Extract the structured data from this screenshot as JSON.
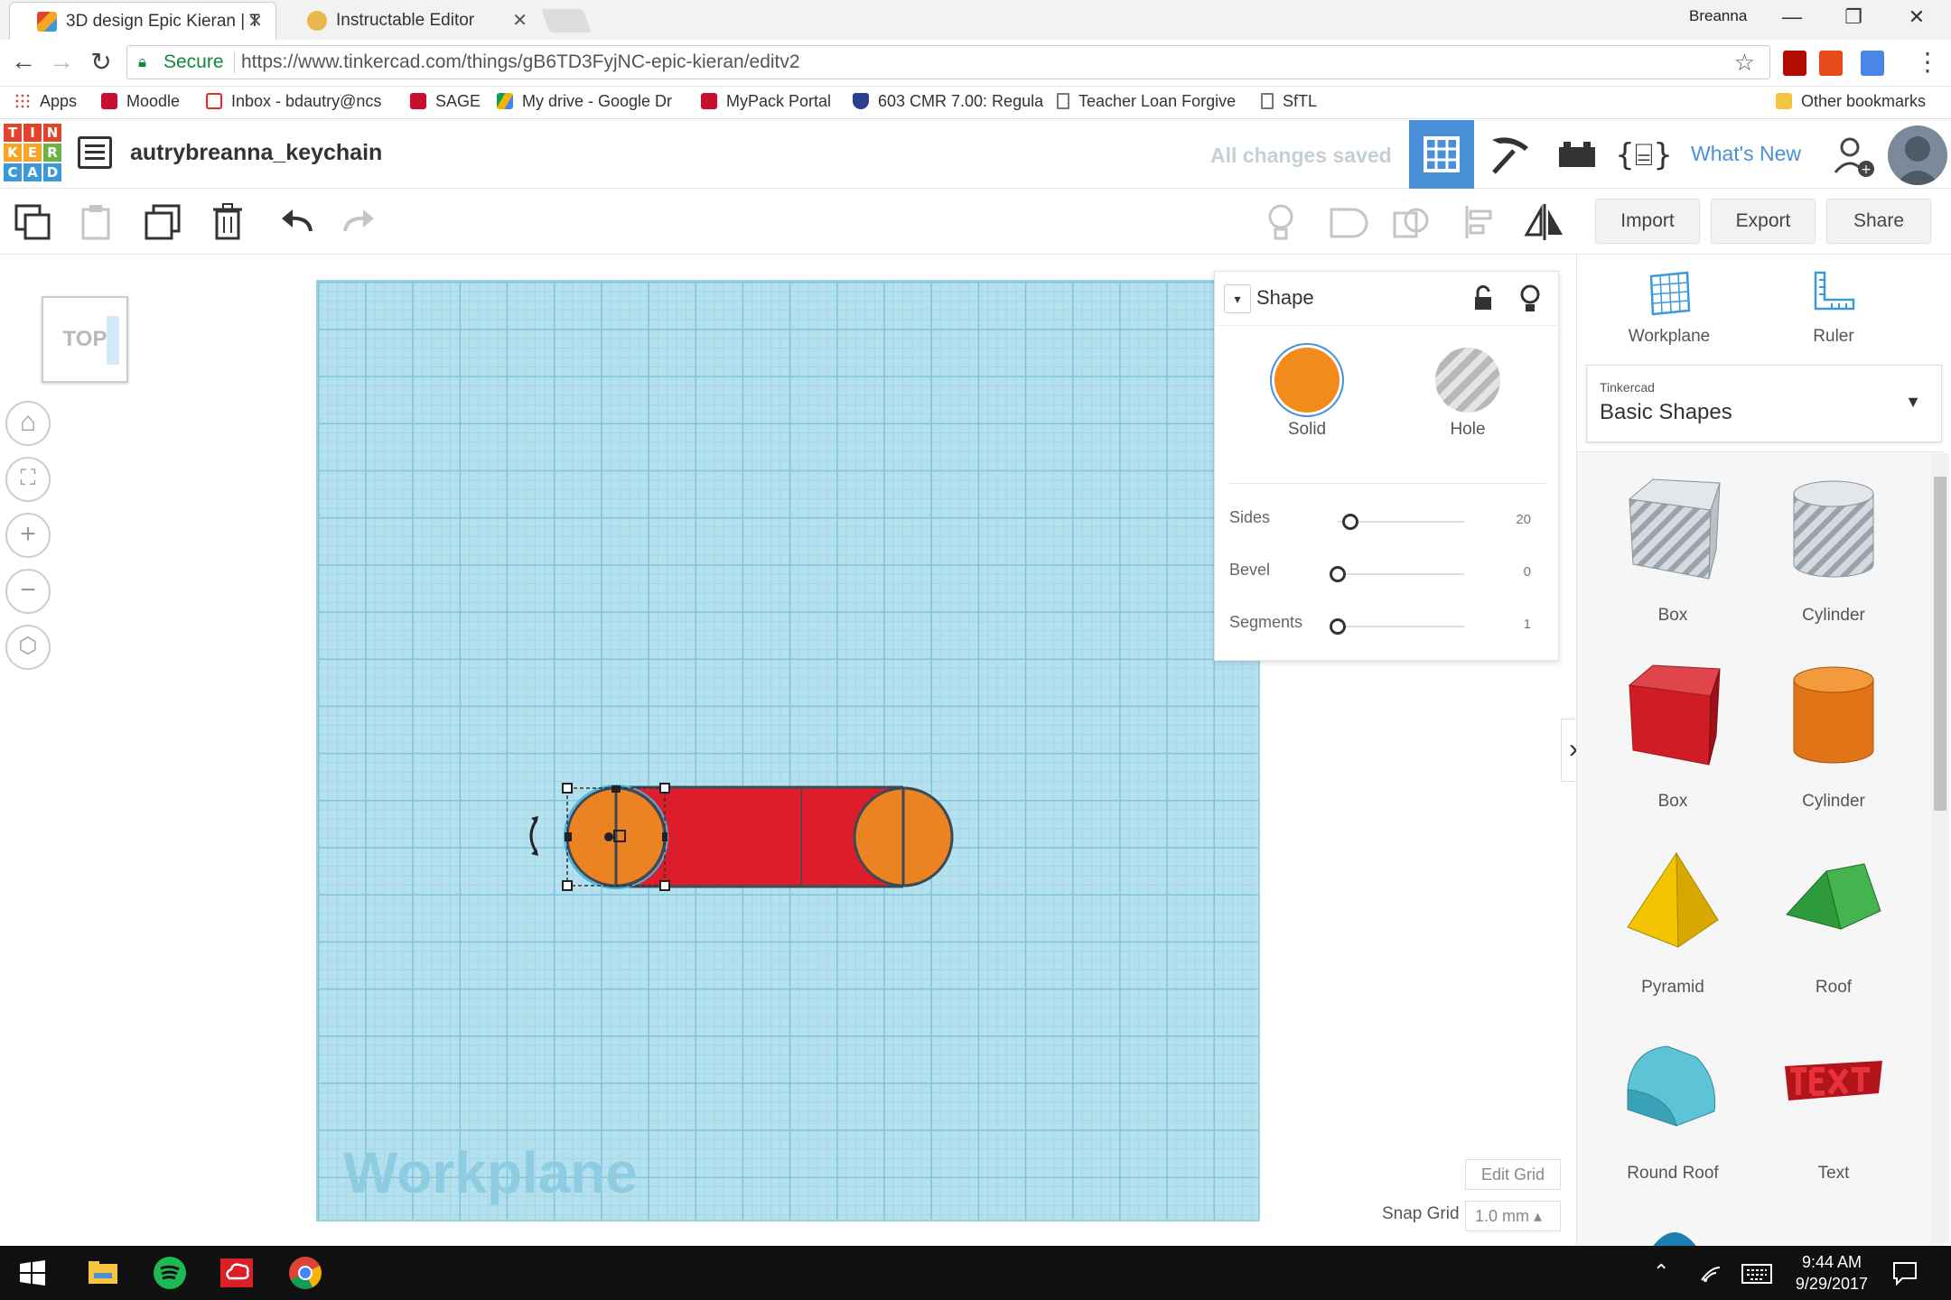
{
  "browser": {
    "tabs": [
      {
        "title": "3D design Epic Kieran | T",
        "active": true
      },
      {
        "title": "Instructable Editor",
        "active": false
      }
    ],
    "profile_name": "Breanna",
    "url_secure_label": "Secure",
    "url": "https://www.tinkercad.com/things/gB6TD3FyjNC-epic-kieran/editv2",
    "bookmarks": [
      "Apps",
      "Moodle",
      "Inbox - bdautry@ncs",
      "SAGE",
      "My drive - Google Dr",
      "MyPack Portal",
      "603 CMR 7.00: Regula",
      "Teacher Loan Forgive",
      "SfTL"
    ],
    "other_bookmarks": "Other bookmarks"
  },
  "app": {
    "logo_letters": [
      "T",
      "I",
      "N",
      "K",
      "E",
      "R",
      "C",
      "A",
      "D"
    ],
    "design_name": "autrybreanna_keychain",
    "save_status": "All changes saved",
    "whats_new": "What's New",
    "import_label": "Import",
    "export_label": "Export",
    "share_label": "Share"
  },
  "view": {
    "cube_face": "TOP",
    "workplane_label": "Workplane",
    "edit_grid": "Edit Grid",
    "snap_grid_label": "Snap Grid",
    "snap_grid_value": "1.0 mm ▴"
  },
  "inspector": {
    "title": "Shape",
    "solid_label": "Solid",
    "hole_label": "Hole",
    "solid_color": "#f28a1c",
    "props": [
      {
        "name": "Sides",
        "value": "20",
        "fraction": 0.1
      },
      {
        "name": "Bevel",
        "value": "0",
        "fraction": 0.0
      },
      {
        "name": "Segments",
        "value": "1",
        "fraction": 0.0
      }
    ]
  },
  "library": {
    "workplane_tool": "Workplane",
    "ruler_tool": "Ruler",
    "category_small": "Tinkercad",
    "category": "Basic Shapes",
    "shapes": [
      {
        "label": "Box",
        "icon": "box-hole-icon"
      },
      {
        "label": "Cylinder",
        "icon": "cylinder-hole-icon"
      },
      {
        "label": "Box",
        "icon": "box-icon"
      },
      {
        "label": "Cylinder",
        "icon": "cylinder-icon"
      },
      {
        "label": "Pyramid",
        "icon": "pyramid-icon"
      },
      {
        "label": "Roof",
        "icon": "roof-icon"
      },
      {
        "label": "Round Roof",
        "icon": "round-roof-icon"
      },
      {
        "label": "Text",
        "icon": "text-shape-icon"
      }
    ]
  },
  "taskbar": {
    "time": "9:44 AM",
    "date": "9/29/2017"
  }
}
